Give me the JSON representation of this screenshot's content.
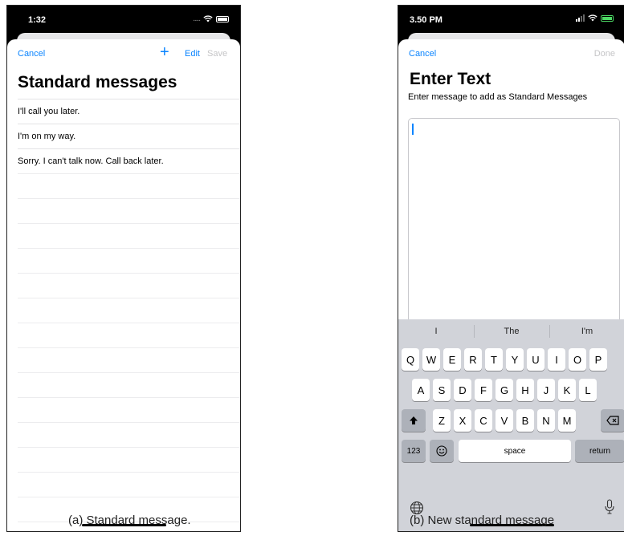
{
  "phone_a": {
    "status_time": "1:32",
    "status_dots": ".....",
    "nav": {
      "cancel": "Cancel",
      "add": "+",
      "edit": "Edit",
      "save": "Save"
    },
    "title": "Standard messages",
    "messages": [
      "I'll call you later.",
      "I'm on my way.",
      "Sorry. I can't talk now. Call back later."
    ]
  },
  "phone_b": {
    "status_time": "3.50 PM",
    "nav": {
      "cancel": "Cancel",
      "done": "Done"
    },
    "title": "Enter Text",
    "subtitle": "Enter message to add as Standard Messages",
    "text_value": "",
    "suggestions": [
      "I",
      "The",
      "I'm"
    ],
    "keyboard": {
      "row1": [
        "Q",
        "W",
        "E",
        "R",
        "T",
        "Y",
        "U",
        "I",
        "O",
        "P"
      ],
      "row2": [
        "A",
        "S",
        "D",
        "F",
        "G",
        "H",
        "J",
        "K",
        "L"
      ],
      "row3": [
        "Z",
        "X",
        "C",
        "V",
        "B",
        "N",
        "M"
      ],
      "numbers_key": "123",
      "space_key": "space",
      "return_key": "return"
    }
  },
  "captions": {
    "a": "(a) Standard message.",
    "b": "(b) New standard message"
  },
  "colors": {
    "accent": "#0a84ff",
    "disabled": "#c5c5c7",
    "keyboard_bg": "#d1d3d9",
    "battery_charging": "#4cd964"
  },
  "icons": [
    "wifi-icon",
    "battery-icon",
    "signal-icon",
    "shift-icon",
    "backspace-icon",
    "emoji-icon",
    "globe-icon",
    "microphone-icon"
  ]
}
